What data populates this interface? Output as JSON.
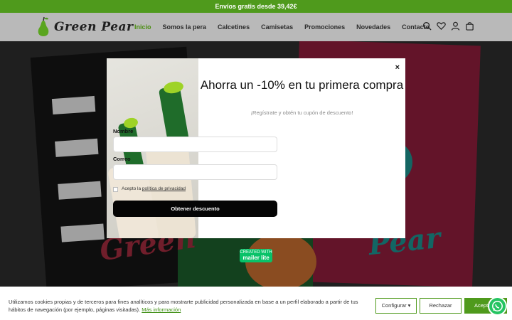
{
  "topbar": {
    "text": "Envíos gratis desde 39,42€"
  },
  "header": {
    "logo_text": "Green Pear",
    "nav": [
      {
        "label": "Inicio"
      },
      {
        "label": "Somos la pera"
      },
      {
        "label": "Calcetines"
      },
      {
        "label": "Camisetas"
      },
      {
        "label": "Promociones"
      },
      {
        "label": "Novedades"
      },
      {
        "label": "Contacto"
      }
    ],
    "icons": [
      "search-icon",
      "heart-icon",
      "user-icon",
      "cart-icon"
    ]
  },
  "hero": {
    "word_left": "Green",
    "word_right": "Pear"
  },
  "modal": {
    "title": "Ahorra un -10% en tu primera compra",
    "subtitle": "¡Regístrate y obtén tu cupón de descuento!",
    "name_label": "Nombre",
    "email_label": "Correo",
    "consent_prefix": "Acepto la",
    "consent_link": "política de privacidad",
    "submit_label": "Obtener descuento",
    "close_label": "×"
  },
  "mailer_badge": {
    "small": "CREATED WITH",
    "big": "mailer lite"
  },
  "cookie": {
    "text": "Utilizamos cookies propias y de terceros para fines analíticos y para mostrarte publicidad personalizada en base a un perfil elaborado a partir de tus hábitos de navegación (por ejemplo, páginas visitadas).",
    "more_link": "Más información",
    "configure_label": "Configurar ▾",
    "reject_label": "Rechazar",
    "accept_label": "Aceptar"
  },
  "colors": {
    "brand_green": "#4f9a1c",
    "whatsapp_green": "#25c462"
  }
}
